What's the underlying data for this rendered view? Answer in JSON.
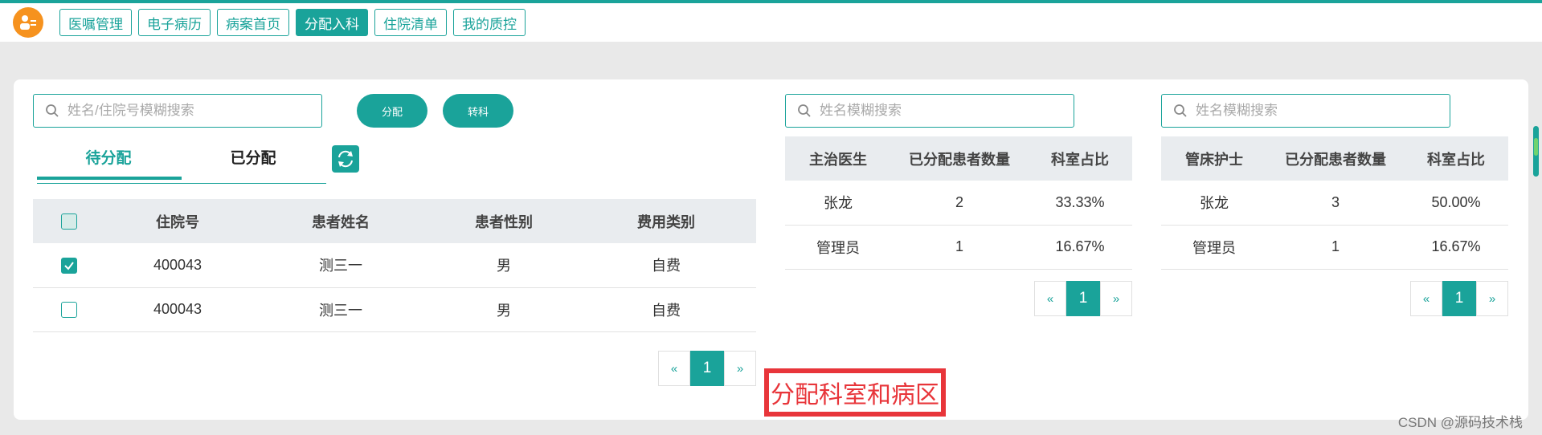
{
  "nav": {
    "tabs": [
      "医嘱管理",
      "电子病历",
      "病案首页",
      "分配入科",
      "住院清单",
      "我的质控"
    ],
    "active_index": 3
  },
  "left_panel": {
    "search_placeholder": "姓名/住院号模糊搜索",
    "assign_label": "分配",
    "transfer_label": "转科",
    "tabs": [
      "待分配",
      "已分配"
    ],
    "active_tab": 0,
    "table": {
      "columns": [
        "住院号",
        "患者姓名",
        "患者性别",
        "费用类别"
      ],
      "rows": [
        {
          "checked": true,
          "id": "400043",
          "name": "测三一",
          "gender": "男",
          "fee": "自费"
        },
        {
          "checked": false,
          "id": "400043",
          "name": "测三一",
          "gender": "男",
          "fee": "自费"
        }
      ]
    },
    "pager": {
      "prev": "«",
      "page": "1",
      "next": "»"
    }
  },
  "doctor_panel": {
    "search_placeholder": "姓名模糊搜索",
    "columns": [
      "主治医生",
      "已分配患者数量",
      "科室占比"
    ],
    "rows": [
      {
        "name": "张龙",
        "count": "2",
        "ratio": "33.33%"
      },
      {
        "name": "管理员",
        "count": "1",
        "ratio": "16.67%"
      }
    ],
    "pager": {
      "prev": "«",
      "page": "1",
      "next": "»"
    }
  },
  "nurse_panel": {
    "search_placeholder": "姓名模糊搜索",
    "columns": [
      "管床护士",
      "已分配患者数量",
      "科室占比"
    ],
    "rows": [
      {
        "name": "张龙",
        "count": "3",
        "ratio": "50.00%"
      },
      {
        "name": "管理员",
        "count": "1",
        "ratio": "16.67%"
      }
    ],
    "pager": {
      "prev": "«",
      "page": "1",
      "next": "»"
    }
  },
  "annotation": "分配科室和病区",
  "watermark": "CSDN @源码技术栈",
  "colors": {
    "accent": "#1aa39a",
    "logo": "#f6921e",
    "annotation": "#e8353a"
  }
}
